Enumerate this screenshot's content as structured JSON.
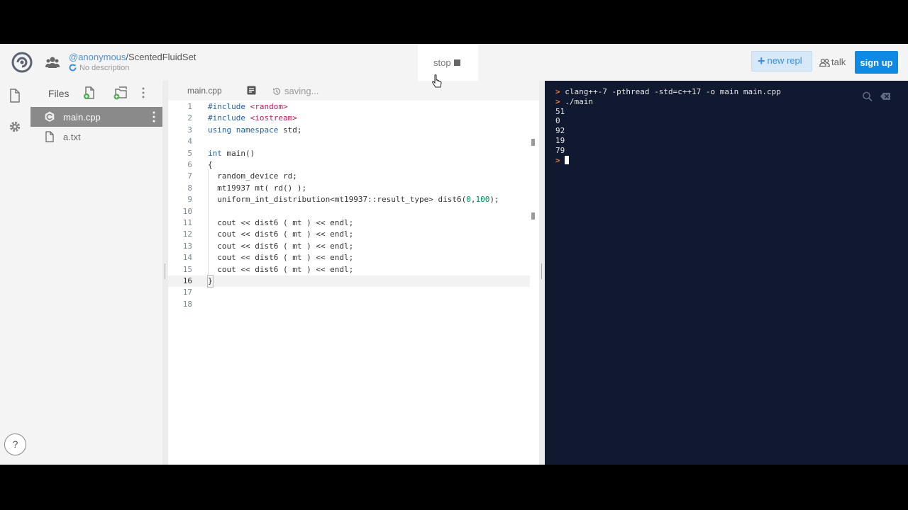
{
  "header": {
    "owner": "@anonymous",
    "repl_name": "/ScentedFluidSet",
    "description": "No description",
    "stop_label": "stop",
    "new_repl_plus": "+",
    "new_repl_label": "new repl",
    "talk_label": "talk",
    "signup_label": "sign up"
  },
  "files": {
    "title": "Files",
    "items": [
      {
        "name": "main.cpp",
        "active": true
      },
      {
        "name": "a.txt",
        "active": false
      }
    ]
  },
  "help_label": "?",
  "editor": {
    "tab_label": "main.cpp",
    "status": "saving...",
    "active_line": 16,
    "lines": [
      {
        "n": "1",
        "code": "#include <random>"
      },
      {
        "n": "2",
        "code": "#include <iostream>"
      },
      {
        "n": "3",
        "code": "using namespace std;"
      },
      {
        "n": "4",
        "code": ""
      },
      {
        "n": "5",
        "code": "int main()"
      },
      {
        "n": "6",
        "code": "{"
      },
      {
        "n": "7",
        "code": "  random_device rd;"
      },
      {
        "n": "8",
        "code": "  mt19937 mt( rd() );"
      },
      {
        "n": "9",
        "code": "  uniform_int_distribution<mt19937::result_type> dist6(0,100);"
      },
      {
        "n": "10",
        "code": ""
      },
      {
        "n": "11",
        "code": "  cout << dist6 ( mt ) << endl;"
      },
      {
        "n": "12",
        "code": "  cout << dist6 ( mt ) << endl;"
      },
      {
        "n": "13",
        "code": "  cout << dist6 ( mt ) << endl;"
      },
      {
        "n": "14",
        "code": "  cout << dist6 ( mt ) << endl;"
      },
      {
        "n": "15",
        "code": "  cout << dist6 ( mt ) << endl;"
      },
      {
        "n": "16",
        "code": "}"
      },
      {
        "n": "17",
        "code": ""
      },
      {
        "n": "18",
        "code": ""
      }
    ]
  },
  "terminal": {
    "prompt_symbol": ">",
    "lines": [
      {
        "prompt": true,
        "text": "clang++-7 -pthread -std=c++17 -o main main.cpp"
      },
      {
        "prompt": true,
        "text": "./main"
      },
      {
        "prompt": false,
        "text": "51"
      },
      {
        "prompt": false,
        "text": "0"
      },
      {
        "prompt": false,
        "text": "92"
      },
      {
        "prompt": false,
        "text": "19"
      },
      {
        "prompt": false,
        "text": "79"
      }
    ]
  },
  "colors": {
    "accent": "#0e8ae4",
    "terminal_bg": "#101930",
    "prompt": "#f07c3c",
    "active_file_bg": "#8a8a8a"
  },
  "icons": [
    "logo-icon",
    "users-icon",
    "refresh-icon",
    "stop-icon",
    "pointer-cursor-icon",
    "plus-icon",
    "talk-icon",
    "file-icon",
    "settings-icon",
    "help-icon",
    "add-file-icon",
    "add-folder-icon",
    "kebab-icon",
    "cpp-icon",
    "format-icon",
    "history-icon",
    "search-icon",
    "clear-icon"
  ]
}
